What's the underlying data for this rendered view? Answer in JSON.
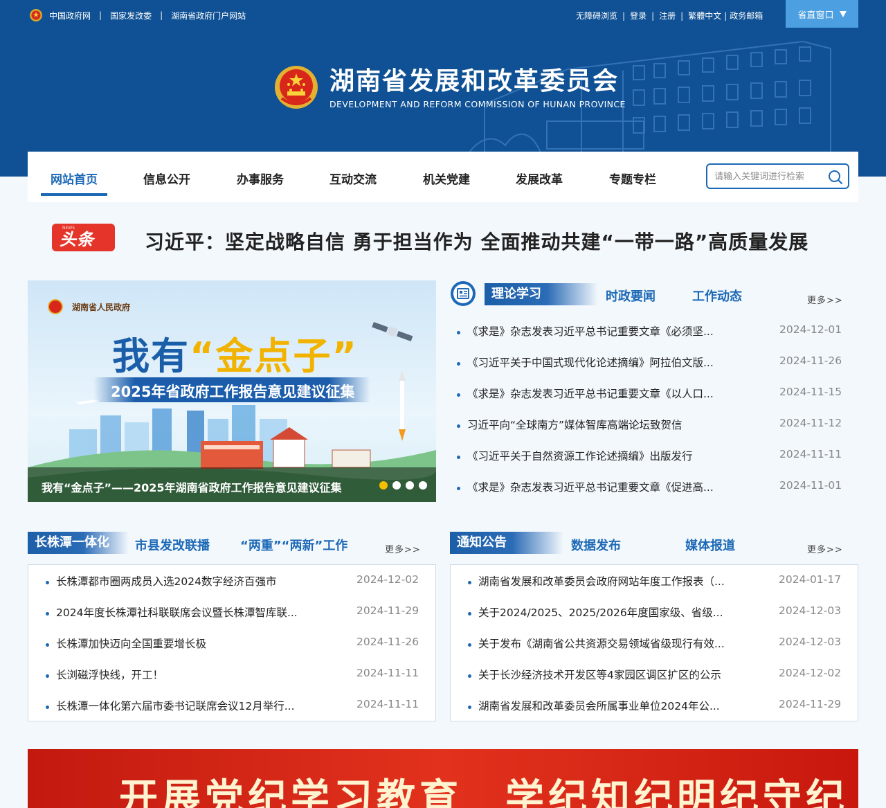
{
  "topbar": {
    "left_links": [
      "中国政府网",
      "国家发改委",
      "湖南省政府门户网站"
    ],
    "right_links": [
      "无障碍浏览",
      "登录",
      "注册",
      "繁體中文",
      "政务邮箱"
    ],
    "province_window": "省直窗口"
  },
  "site": {
    "title_cn": "湖南省发展和改革委员会",
    "title_en": "DEVELOPMENT AND REFORM COMMISSION OF HUNAN PROVINCE"
  },
  "nav": {
    "items": [
      "网站首页",
      "信息公开",
      "办事服务",
      "互动交流",
      "机关党建",
      "发展改革",
      "专题专栏"
    ],
    "search_placeholder": "请输入关键词进行检索"
  },
  "headline": {
    "badge": "头条",
    "badge_small": "NEWS",
    "text": "习近平：坚定战略自信 勇于担当作为 全面推动共建“一带一路”高质量发展"
  },
  "banner": {
    "gov_label": "湖南省人民政府",
    "big_prefix": "我有",
    "big_gold": "“金点子”",
    "sub": "2025年省政府工作报告意见建议征集",
    "caption": "我有“金点子”——2025年湖南省政府工作报告意见建议征集",
    "slides": 4,
    "current_slide": 1
  },
  "panel_theory": {
    "tabs": [
      "理论学习",
      "时政要闻",
      "工作动态"
    ],
    "more": "更多>>",
    "items": [
      {
        "title": "《求是》杂志发表习近平总书记重要文章《必须坚...",
        "date": "2024-12-01"
      },
      {
        "title": "《习近平关于中国式现代化论述摘编》阿拉伯文版...",
        "date": "2024-11-26"
      },
      {
        "title": "《求是》杂志发表习近平总书记重要文章《以人口...",
        "date": "2024-11-15"
      },
      {
        "title": "习近平向“全球南方”媒体智库高端论坛致贺信",
        "date": "2024-11-12"
      },
      {
        "title": "《习近平关于自然资源工作论述摘编》出版发行",
        "date": "2024-11-11"
      },
      {
        "title": "《求是》杂志发表习近平总书记重要文章《促进高...",
        "date": "2024-11-01"
      }
    ]
  },
  "panel_czt": {
    "tabs": [
      "长株潭一体化",
      "市县发改联播",
      "“两重”“两新”工作"
    ],
    "more": "更多>>",
    "items": [
      {
        "title": "长株潭都市圈两成员入选2024数字经济百强市",
        "date": "2024-12-02"
      },
      {
        "title": "2024年度长株潭社科联联席会议暨长株潭智库联...",
        "date": "2024-11-29"
      },
      {
        "title": "长株潭加快迈向全国重要增长极",
        "date": "2024-11-26"
      },
      {
        "title": "长浏磁浮快线，开工！",
        "date": "2024-11-11"
      },
      {
        "title": "长株潭一体化第六届市委书记联席会议12月举行...",
        "date": "2024-11-11"
      }
    ]
  },
  "panel_notice": {
    "tabs": [
      "通知公告",
      "数据发布",
      "媒体报道"
    ],
    "more": "更多>>",
    "items": [
      {
        "title": "湖南省发展和改革委员会政府网站年度工作报表（...",
        "date": "2024-01-17"
      },
      {
        "title": "关于2024/2025、2025/2026年度国家级、省级...",
        "date": "2024-12-03"
      },
      {
        "title": "关于发布《湖南省公共资源交易领域省级现行有效...",
        "date": "2024-12-03"
      },
      {
        "title": "关于长沙经济技术开发区等4家园区调区扩区的公示",
        "date": "2024-12-02"
      },
      {
        "title": "湖南省发展和改革委员会所属事业单位2024年公...",
        "date": "2024-11-29"
      }
    ]
  },
  "red_banner": {
    "slogan": "开展党纪学习教育　学纪知纪明纪守纪"
  },
  "colors": {
    "header_bg": "#0f5194",
    "accent": "#1d69b6",
    "headline_red": "#e5352b",
    "province_btn": "#4c9fe0"
  }
}
